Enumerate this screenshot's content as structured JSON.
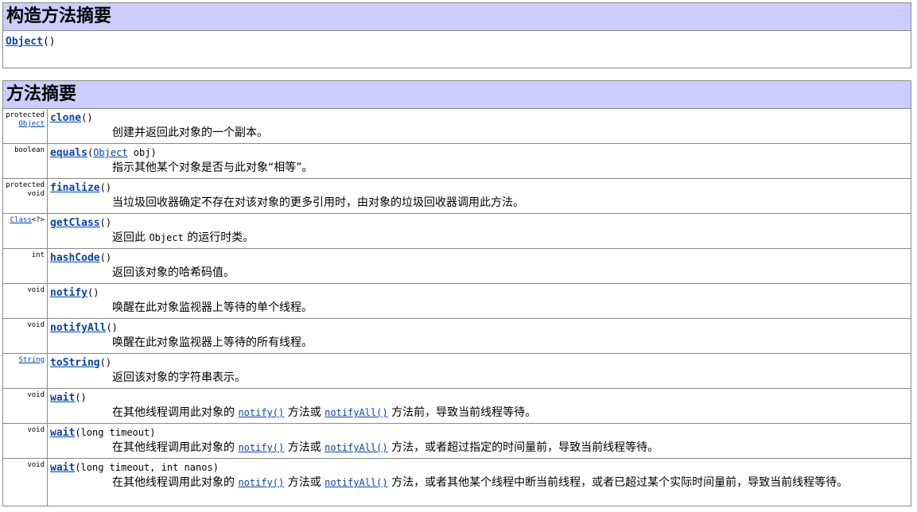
{
  "constructor_section": {
    "title": "构造方法摘要",
    "ctor_name": "Object",
    "ctor_params": "()"
  },
  "method_section": {
    "title": "方法摘要",
    "rows": [
      {
        "type_line1": "protected",
        "type_link": "Object",
        "name": "clone",
        "params": "()",
        "desc": "创建并返回此对象的一个副本。"
      },
      {
        "type_line1": "boolean",
        "name": "equals",
        "params_open": "(",
        "param_link": "Object",
        "params_rest": " obj)",
        "desc": "指示其他某个对象是否与此对象“相等”。"
      },
      {
        "type_line1": "protected",
        "type_line2": "void",
        "name": "finalize",
        "params": "()",
        "desc": "当垃圾回收器确定不存在对该对象的更多引用时，由对象的垃圾回收器调用此方法。"
      },
      {
        "type_link": "Class",
        "type_suffix": "<?>",
        "name": "getClass",
        "params": "()",
        "desc_pre": "返回此 ",
        "desc_code": "Object",
        "desc_post": " 的运行时类。"
      },
      {
        "type_line1": "int",
        "name": "hashCode",
        "params": "()",
        "desc": "返回该对象的哈希码值。"
      },
      {
        "type_line1": "void",
        "name": "notify",
        "params": "()",
        "desc": "唤醒在此对象监视器上等待的单个线程。"
      },
      {
        "type_line1": "void",
        "name": "notifyAll",
        "params": "()",
        "desc": "唤醒在此对象监视器上等待的所有线程。"
      },
      {
        "type_link": "String",
        "name": "toString",
        "params": "()",
        "desc": "返回该对象的字符串表示。"
      },
      {
        "type_line1": "void",
        "name": "wait",
        "params": "()",
        "desc_pre": "在其他线程调用此对象的 ",
        "link1": "notify()",
        "desc_mid": " 方法或 ",
        "link2": "notifyAll()",
        "desc_post": " 方法前，导致当前线程等待。"
      },
      {
        "type_line1": "void",
        "name": "wait",
        "params": "(long timeout)",
        "desc_pre": "在其他线程调用此对象的 ",
        "link1": "notify()",
        "desc_mid": " 方法或 ",
        "link2": "notifyAll()",
        "desc_post": " 方法，或者超过指定的时间量前，导致当前线程等待。"
      },
      {
        "type_line1": "void",
        "name": "wait",
        "params": "(long timeout, int nanos)",
        "desc_pre": "在其他线程调用此对象的 ",
        "link1": "notify()",
        "desc_mid": " 方法或 ",
        "link2": "notifyAll()",
        "desc_post": " 方法，或者其他某个线程中断当前线程，或者已超过某个实际时间量前，导致当前线程等待。"
      }
    ]
  }
}
